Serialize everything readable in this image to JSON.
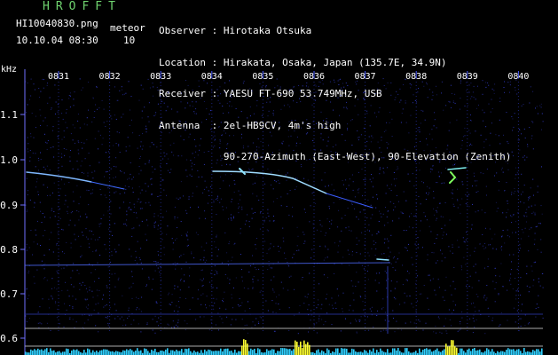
{
  "header": {
    "app_title": "HROFFT",
    "filename": "HI10040830.png",
    "datetime": "10.10.04 08:30",
    "mode_label": "meteor",
    "mode_value": "10"
  },
  "station_info": [
    {
      "key": "Observer",
      "value": "Hirotaka Otsuka"
    },
    {
      "key": "Location",
      "value": "Hirakata, Osaka, Japan (135.7E, 34.9N)"
    },
    {
      "key": "Receiver",
      "value": "YAESU FT-690 53.749MHz, USB"
    },
    {
      "key": "Antenna",
      "value": "2el-HB9CV, 4m's high"
    },
    {
      "key": "",
      "value": "90-270-Azimuth (East-West), 90-Elevation (Zenith)"
    }
  ],
  "axis": {
    "unit_label": "kHz",
    "time_ticks": [
      "0831",
      "0832",
      "0833",
      "0834",
      "0835",
      "0836",
      "0837",
      "0838",
      "0839",
      "0840"
    ],
    "freq_ticks": [
      "1.1",
      "1.0",
      "0.9",
      "0.8",
      "0.7",
      "0.6"
    ]
  },
  "colors": {
    "background": "#000000",
    "title_green": "#6fd36f",
    "grid_blue": "#3b4cff",
    "echo_cyan": "#8fe4ff",
    "level_cyan": "#30d0ff",
    "level_yellow": "#ffff30"
  }
}
